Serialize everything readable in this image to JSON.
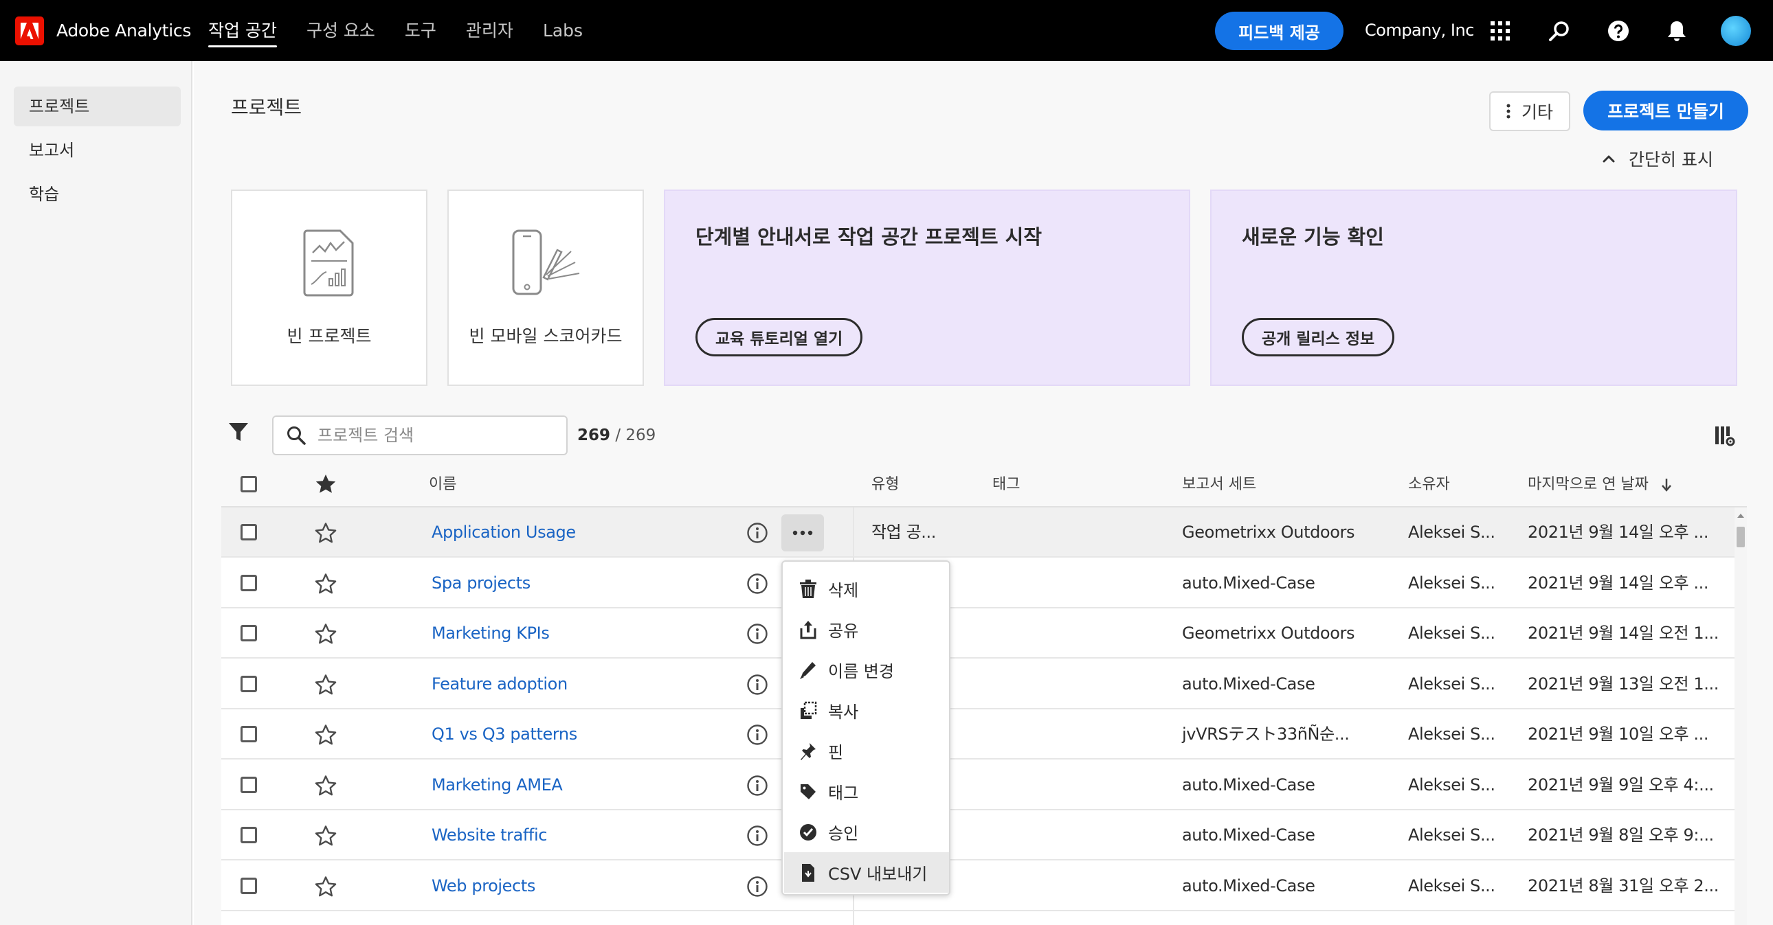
{
  "app": {
    "name": "Adobe Analytics",
    "company": "Company, Inc",
    "brand_color": "#eb1000",
    "accent_color": "#1473e6"
  },
  "nav": [
    "작업 공간",
    "구성 요소",
    "도구",
    "관리자",
    "Labs"
  ],
  "feedback_label": "피드백 제공",
  "top_icons": [
    "apps-grid-icon",
    "search-icon",
    "help-icon",
    "bell-icon",
    "avatar"
  ],
  "sidebar": {
    "items": [
      {
        "label": "프로젝트",
        "active": true
      },
      {
        "label": "보고서",
        "active": false
      },
      {
        "label": "학습",
        "active": false
      }
    ]
  },
  "page": {
    "title": "프로젝트",
    "more_label": "기타",
    "create_label": "프로젝트 만들기",
    "collapse_label": "간단히 표시"
  },
  "cards": [
    {
      "label": "빈 프로젝트",
      "icon": "blank-project-icon"
    },
    {
      "label": "빈 모바일 스코어카드",
      "icon": "mobile-scorecard-icon"
    }
  ],
  "promos": [
    {
      "title": "단계별 안내서로 작업 공간 프로젝트 시작",
      "button": "교육 튜토리얼 열기"
    },
    {
      "title": "새로운 기능 확인",
      "button": "공개 릴리스 정보"
    }
  ],
  "search": {
    "placeholder": "프로젝트 검색",
    "count_shown": "269",
    "count_total": "/ 269"
  },
  "table": {
    "columns": {
      "name": "이름",
      "type": "유형",
      "tags": "태그",
      "report_suite": "보고서 세트",
      "owner": "소유자",
      "last_opened": "마지막으로 연 날짜"
    },
    "rows": [
      {
        "name": "Application Usage",
        "type": "작업 공...",
        "report_suite": "Geometrixx Outdoors",
        "owner": "Aleksei S...",
        "date": "2021년 9월 14일 오후 ..."
      },
      {
        "name": "Spa projects",
        "type": "",
        "report_suite": "auto.Mixed-Case",
        "owner": "Aleksei S...",
        "date": "2021년 9월 14일 오후 ..."
      },
      {
        "name": "Marketing KPIs",
        "type": "",
        "report_suite": "Geometrixx Outdoors",
        "owner": "Aleksei S...",
        "date": "2021년 9월 14일 오전 1..."
      },
      {
        "name": "Feature adoption",
        "type": "",
        "report_suite": "auto.Mixed-Case",
        "owner": "Aleksei S...",
        "date": "2021년 9월 13일 오전 1..."
      },
      {
        "name": "Q1 vs Q3 patterns",
        "type": "",
        "report_suite": "jvVRSテスト33ñÑ순...",
        "owner": "Aleksei S...",
        "date": "2021년 9월 10일 오후 ..."
      },
      {
        "name": "Marketing AMEA",
        "type": "",
        "report_suite": "auto.Mixed-Case",
        "owner": "Aleksei S...",
        "date": "2021년 9월 9일 오후 4:..."
      },
      {
        "name": "Website traffic",
        "type": "",
        "report_suite": "auto.Mixed-Case",
        "owner": "Aleksei S...",
        "date": "2021년 9월 8일 오후 9:..."
      },
      {
        "name": "Web projects",
        "type": "",
        "report_suite": "auto.Mixed-Case",
        "owner": "Aleksei S...",
        "date": "2021년 8월 31일 오후 2..."
      }
    ]
  },
  "context_menu": [
    {
      "label": "삭제",
      "icon": "trash-icon"
    },
    {
      "label": "공유",
      "icon": "share-icon"
    },
    {
      "label": "이름 변경",
      "icon": "pencil-icon"
    },
    {
      "label": "복사",
      "icon": "copy-icon"
    },
    {
      "label": "핀",
      "icon": "pin-icon"
    },
    {
      "label": "태그",
      "icon": "tag-icon"
    },
    {
      "label": "승인",
      "icon": "checkmark-circle-icon"
    },
    {
      "label": "CSV 내보내기",
      "icon": "csv-file-icon"
    }
  ]
}
